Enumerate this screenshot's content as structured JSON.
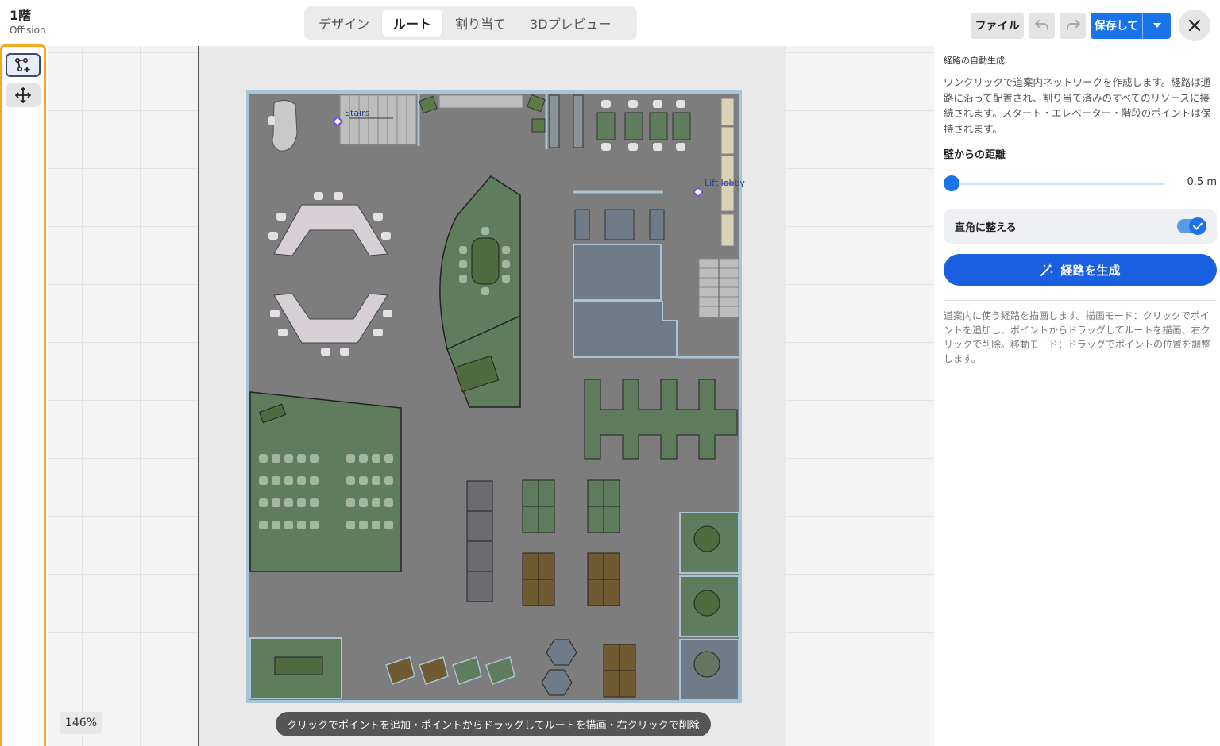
{
  "floor": {
    "name": "1階",
    "building": "Offision"
  },
  "tabs": [
    {
      "label": "デザイン",
      "active": false
    },
    {
      "label": "ルート",
      "active": true
    },
    {
      "label": "割り当て",
      "active": false
    },
    {
      "label": "3Dプレビュー",
      "active": false
    }
  ],
  "toolbar": {
    "file_label": "ファイル",
    "undo_icon": "undo-icon",
    "redo_icon": "redo-icon",
    "save_label": "保存して",
    "save_dropdown_icon": "caret-down-icon",
    "close_icon": "close-icon"
  },
  "left_tools": [
    {
      "name": "route-draw-tool",
      "icon": "route-nodes-add-icon",
      "active": true
    },
    {
      "name": "move-tool",
      "icon": "move-arrows-icon",
      "active": false
    }
  ],
  "canvas": {
    "zoom": "146%",
    "hint": "クリックでポイントを追加・ポイントからドラッグしてルートを描画・右クリックで削除",
    "labels": {
      "stairs": "Stairs",
      "lift_lobby": "Lift lobby"
    }
  },
  "panel": {
    "heading": "経路の自動生成",
    "description": "ワンクリックで道案内ネットワークを作成します。経路は通路に沿って配置され、割り当て済みのすべてのリソースに接続されます。スタート・エレベーター・階段のポイントは保持されます。",
    "wall_distance_label": "壁からの距離",
    "wall_distance_value": "0.5 m",
    "wall_distance": 0.5,
    "wall_distance_fraction": 0.0,
    "orthogonal_label": "直角に整える",
    "orthogonal_enabled": true,
    "generate_label": "経路を生成",
    "generate_icon": "magic-wand-icon",
    "help": "道案内に使う経路を描画します。描画モード：クリックでポイントを追加し、ポイントからドラッグしてルートを描画、右クリックで削除。移動モード：ドラッグでポイントの位置を調整します。"
  },
  "colors": {
    "accent": "#1a73e8",
    "generate_button": "#1a5fe0",
    "tool_border": "#f5a623",
    "floor": "#7d7d7d",
    "room_green": "#5f7c5c",
    "room_slate": "#6f7b86",
    "table_brown": "#6f5a32"
  }
}
